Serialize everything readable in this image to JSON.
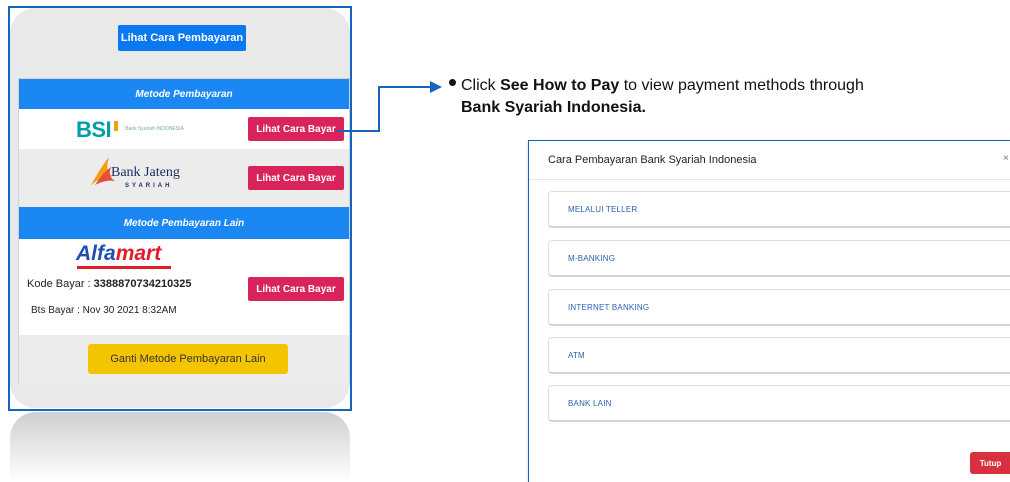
{
  "left_panel": {
    "top_button_label": "Lihat Cara Pembayaran",
    "section1_header": "Metode Pembayaran",
    "bsi": {
      "logo_text": "BSI",
      "logo_subtext": "Bank Syariah INDONESIA",
      "button_label": "Lihat Cara Bayar"
    },
    "jateng": {
      "logo_text": "Bank Jateng",
      "logo_subtext": "SYARIAH",
      "button_label": "Lihat Cara Bayar"
    },
    "section2_header": "Metode Pembayaran Lain",
    "alfamart": {
      "logo_text_alfa": "Alfa",
      "logo_text_mart": "mart",
      "kode_label": "Kode Bayar : ",
      "kode_value": "3388870734210325",
      "bts_text": "Bts Bayar : Nov 30 2021 8:32AM",
      "button_label": "Lihat Cara Bayar"
    },
    "bottom_button_label": "Ganti Metode Pembayaran Lain"
  },
  "annotation": {
    "part1": "Click ",
    "bold1": "See How to Pay",
    "part2": " to view payment methods through",
    "bold2": "Bank Syariah Indonesia."
  },
  "modal": {
    "title": "Cara Pembayaran Bank Syariah Indonesia",
    "close_glyph": "×",
    "options": [
      "MELALUI TELLER",
      "M-BANKING",
      "INTERNET BANKING",
      "ATM",
      "BANK LAIN"
    ],
    "close_button_label": "Tutup"
  },
  "colors": {
    "frame_blue": "#1565c0",
    "button_blue": "#0a78f0",
    "header_blue": "#1a87f2",
    "button_pink": "#d8245a",
    "button_yellow": "#f5c400",
    "button_red": "#d9303d"
  }
}
